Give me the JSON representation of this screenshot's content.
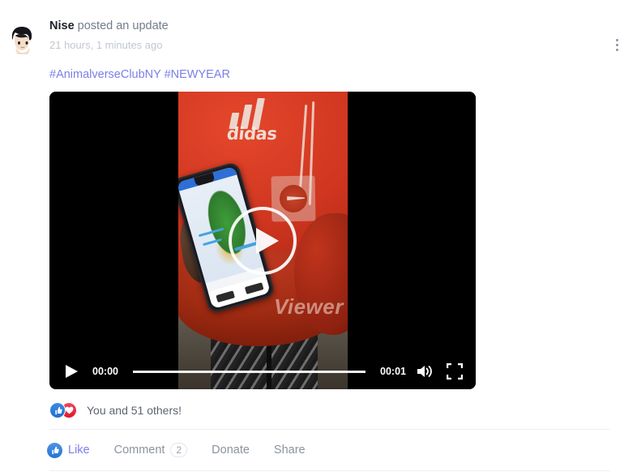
{
  "post": {
    "author": "Nise",
    "action_text": "posted an update",
    "timestamp": "21 hours, 1 minutes ago",
    "hashtags": "#AnimalverseClubNY #NEWYEAR",
    "menu_icon": "kebab-menu-icon",
    "avatar_alt": "Nise avatar"
  },
  "video": {
    "play_overlay_icon": "play-circle-icon",
    "current_time": "00:00",
    "duration": "00:01",
    "play_icon": "play-icon",
    "volume_icon": "volume-high-icon",
    "fullscreen_icon": "fullscreen-icon",
    "progress_percent": 100,
    "watermark": "Viewer",
    "brand_text": "didas"
  },
  "reactions": {
    "summary": "You and 51 others!",
    "icons": [
      "thumbs-up-icon",
      "heart-icon"
    ]
  },
  "actions": {
    "like": "Like",
    "comment": "Comment",
    "comment_count": "2",
    "donate": "Donate",
    "share": "Share"
  },
  "colors": {
    "accent": "#7b7fe8",
    "like_blue": "#2274d8",
    "love_red": "#e4152b",
    "text_primary": "#1d2129",
    "text_muted": "#8c939e",
    "timestamp": "#c2c7d0",
    "divider": "#eceff3"
  }
}
